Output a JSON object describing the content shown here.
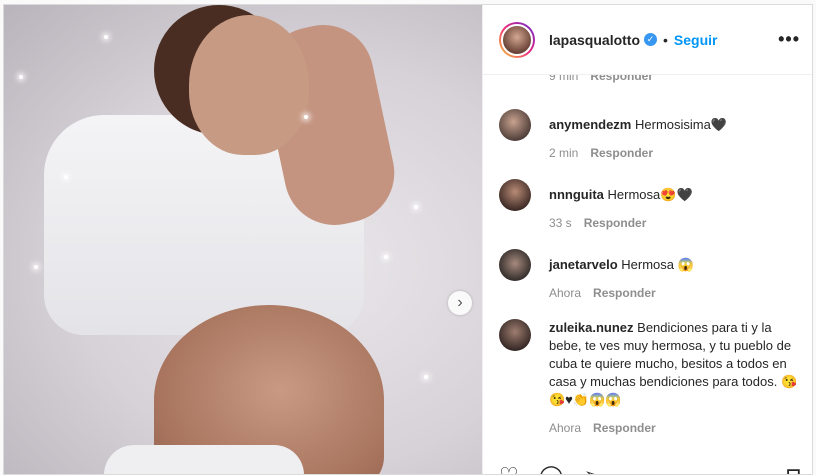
{
  "post": {
    "username": "lapasqualotto",
    "follow_label": "Seguir",
    "dot": "•",
    "more": "•••",
    "next_arrow": "›"
  },
  "partial": {
    "time": "9 min",
    "reply": "Responder"
  },
  "comments": [
    {
      "user": "anymendezm",
      "text": "Hermosisima🖤",
      "time": "2 min",
      "reply": "Responder"
    },
    {
      "user": "nnnguita",
      "text": "Hermosa😍🖤",
      "time": "33 s",
      "reply": "Responder"
    },
    {
      "user": "janetarvelo",
      "text": "Hermosa 😱",
      "time": "Ahora",
      "reply": "Responder"
    },
    {
      "user": "zuleika.nunez",
      "text": "Bendiciones para ti y la bebe, te ves muy hermosa, y tu pueblo de cuba te quiere mucho, besitos a todos en casa y muchas bendiciones para todos. 😘😘♥👏😱😱",
      "time": "Ahora",
      "reply": "Responder"
    }
  ],
  "actions": {
    "like": "♡",
    "comment": "◯",
    "share": "➢",
    "save": "⊓"
  },
  "colors": {
    "follow": "#0095f6",
    "verified": "#3897f0",
    "meta": "#8e8e8e"
  }
}
